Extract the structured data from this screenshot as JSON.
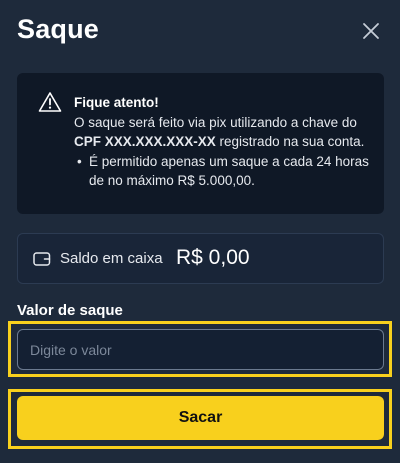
{
  "modal": {
    "title": "Saque",
    "close_icon": "close-icon"
  },
  "warning": {
    "icon": "warning-triangle-icon",
    "title": "Fique atento!",
    "line1": "O saque será feito via pix utilizando a chave do",
    "cpf": "CPF XXX.XXX.XXX-XX",
    "line2_rest": " registrado na sua conta.",
    "bullet": "É permitido apenas um saque a cada 24 horas de no máximo R$ 5.000,00."
  },
  "balance": {
    "icon": "wallet-icon",
    "label": "Saldo em caixa",
    "value": "R$ 0,00"
  },
  "withdraw": {
    "label": "Valor de saque",
    "placeholder": "Digite o valor",
    "value": "",
    "button_label": "Sacar"
  },
  "colors": {
    "background": "#1e2a3b",
    "accent": "#f8d01d",
    "panel": "#0f1826"
  }
}
